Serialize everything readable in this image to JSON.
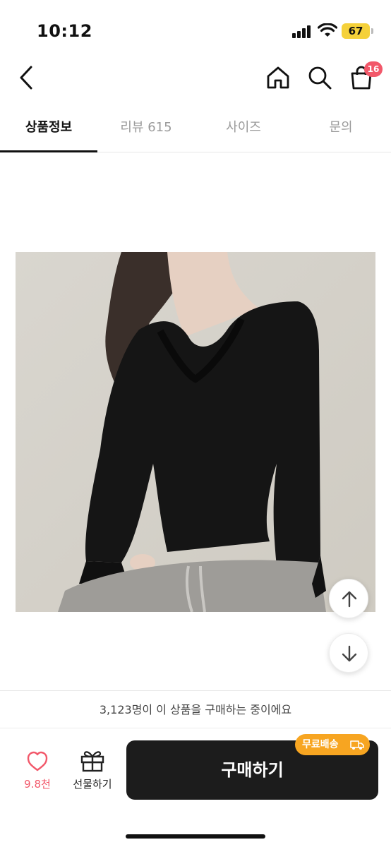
{
  "status": {
    "time": "10:12",
    "battery": "67"
  },
  "nav": {
    "cart_count": "16"
  },
  "tabs": [
    {
      "label": "상품정보",
      "active": true
    },
    {
      "label": "리뷰 615",
      "active": false
    },
    {
      "label": "사이즈",
      "active": false
    },
    {
      "label": "문의",
      "active": false
    }
  ],
  "purchase": {
    "buyers_text": "3,123명이 이 상품을 구매하는 중이에요",
    "like_count": "9.8천",
    "gift_label": "선물하기",
    "buy_label": "구매하기",
    "free_shipping": "무료배송"
  },
  "colors": {
    "accent_pink": "#f2586a",
    "shipping_orange": "#f7a521",
    "buy_button": "#1c1c1c"
  }
}
